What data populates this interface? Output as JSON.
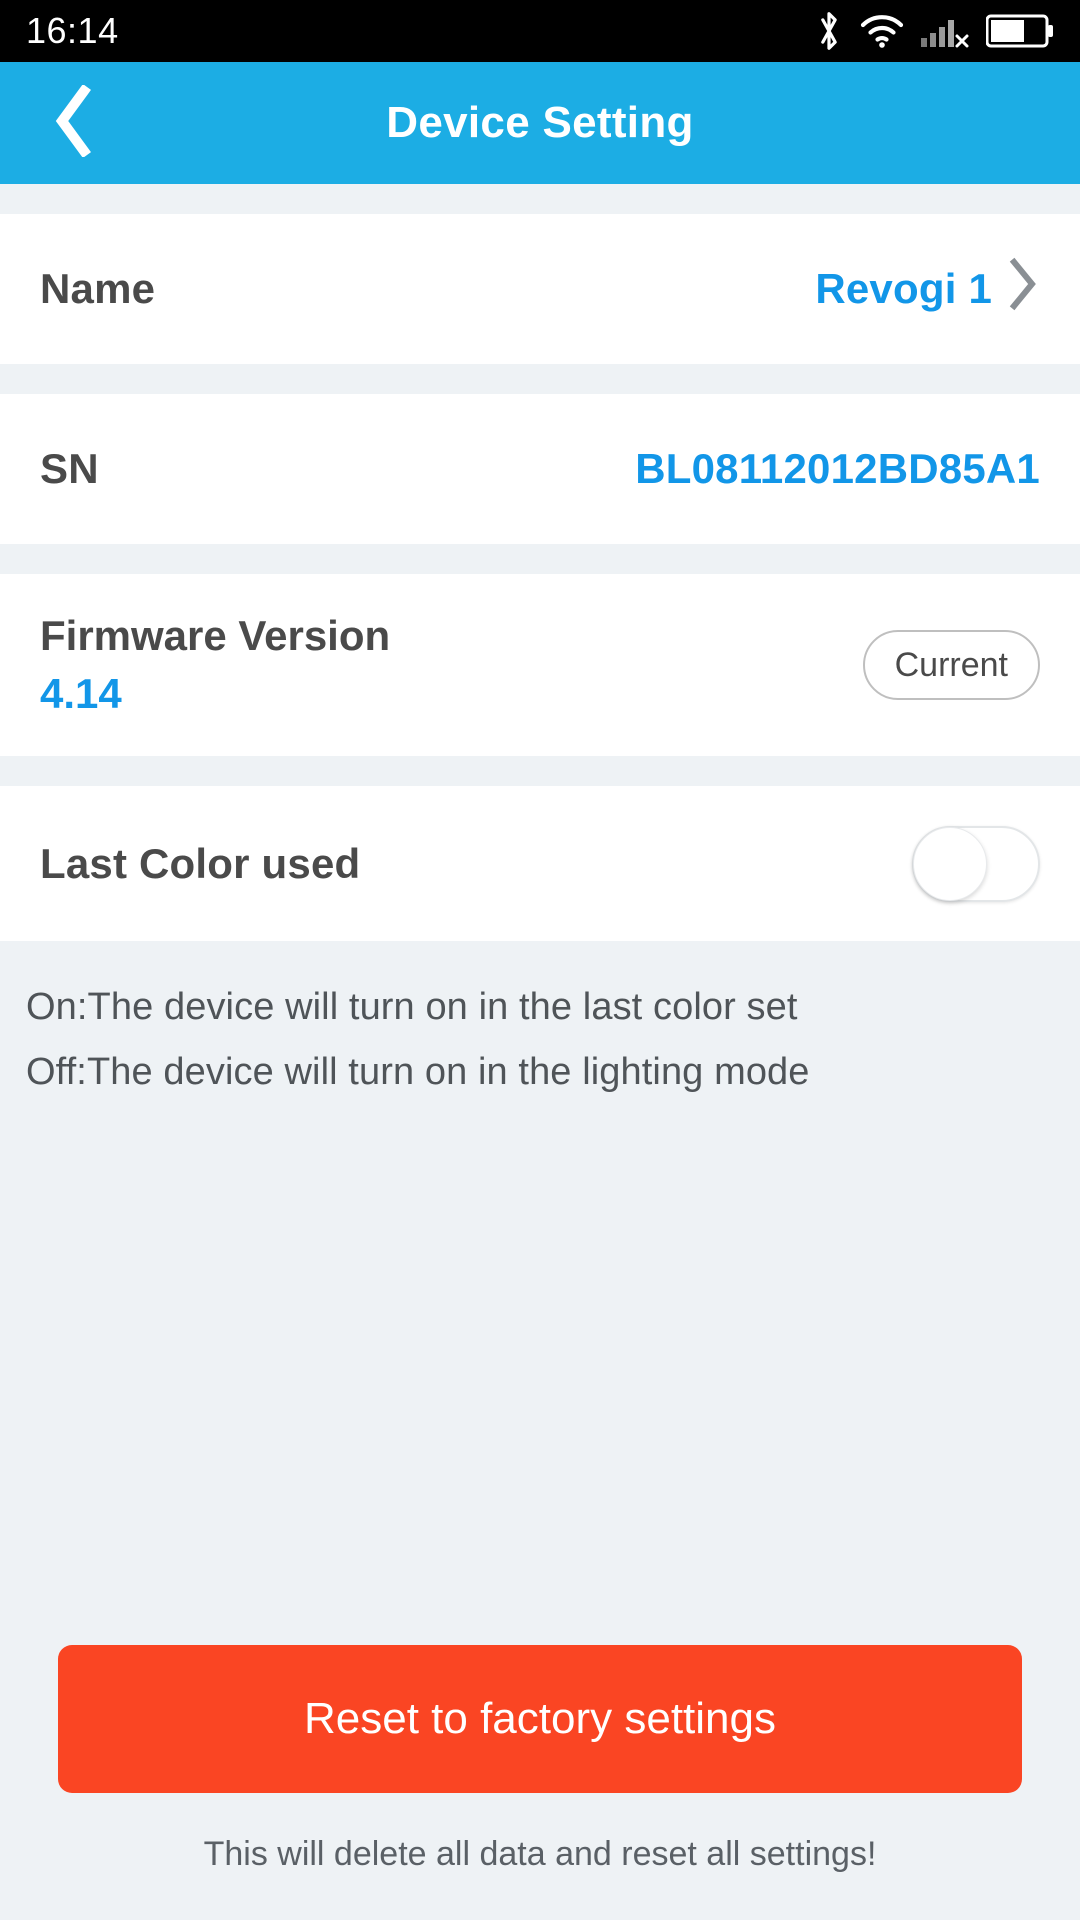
{
  "status_bar": {
    "clock": "16:14",
    "icons": [
      {
        "name": "bluetooth-icon",
        "label": "Bluetooth"
      },
      {
        "name": "wifi-icon",
        "label": "Wi-Fi"
      },
      {
        "name": "cellular-signal-no-service-icon",
        "label": "Cellular no service"
      },
      {
        "name": "battery-icon",
        "label": "Battery",
        "level_percent": 60
      }
    ]
  },
  "header": {
    "title": "Device Setting",
    "back_icon": "chevron-left-icon",
    "background_color": "#1CADE4",
    "title_color": "#FFFFFF"
  },
  "settings": {
    "name_row": {
      "label": "Name",
      "value": "Revogi 1",
      "chevron_icon": "chevron-right-icon"
    },
    "sn_row": {
      "label": "SN",
      "value": "BL08112012BD85A1"
    },
    "firmware_row": {
      "label": "Firmware Version",
      "version": "4.14",
      "button_label": "Current"
    },
    "last_color_row": {
      "label": "Last Color used",
      "toggle_state": "off"
    }
  },
  "description": {
    "line_on": "On:The device will turn on in the last color set",
    "line_off": "Off:The device will turn on in the lighting mode"
  },
  "footer": {
    "reset_button_label": "Reset to factory settings",
    "warning_note": "This will delete all data and reset all settings!"
  },
  "colors": {
    "accent_blue": "#1CADE4",
    "value_blue": "#1296E8",
    "danger_red": "#FA4523",
    "page_background": "#EEF2F5",
    "card_background": "#FFFFFF",
    "label_gray": "#4A4A4A"
  }
}
